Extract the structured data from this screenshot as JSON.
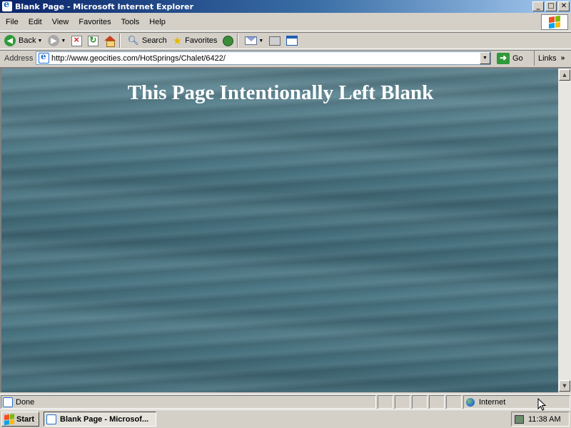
{
  "window": {
    "title": "Blank Page - Microsoft Internet Explorer",
    "minimize": "_",
    "maximize": "□",
    "close": "✕"
  },
  "menu": [
    "File",
    "Edit",
    "View",
    "Favorites",
    "Tools",
    "Help"
  ],
  "toolbar": {
    "back_label": "Back",
    "search_label": "Search",
    "favorites_label": "Favorites"
  },
  "address": {
    "label": "Address",
    "url": "http://www.geocities.com/HotSprings/Chalet/6422/",
    "go_label": "Go",
    "links_label": "Links"
  },
  "page": {
    "heading": "This Page Intentionally Left Blank",
    "background": "ocean-waves-texture"
  },
  "status": {
    "text": "Done",
    "zone": "Internet"
  },
  "taskbar": {
    "start_label": "Start",
    "task_label": "Blank Page - Microsof...",
    "clock": "11:38 AM"
  },
  "colors": {
    "titlebar_start": "#0a246a",
    "titlebar_end": "#a6caf0",
    "chrome": "#d4d0c8",
    "water": "#4a7583"
  }
}
